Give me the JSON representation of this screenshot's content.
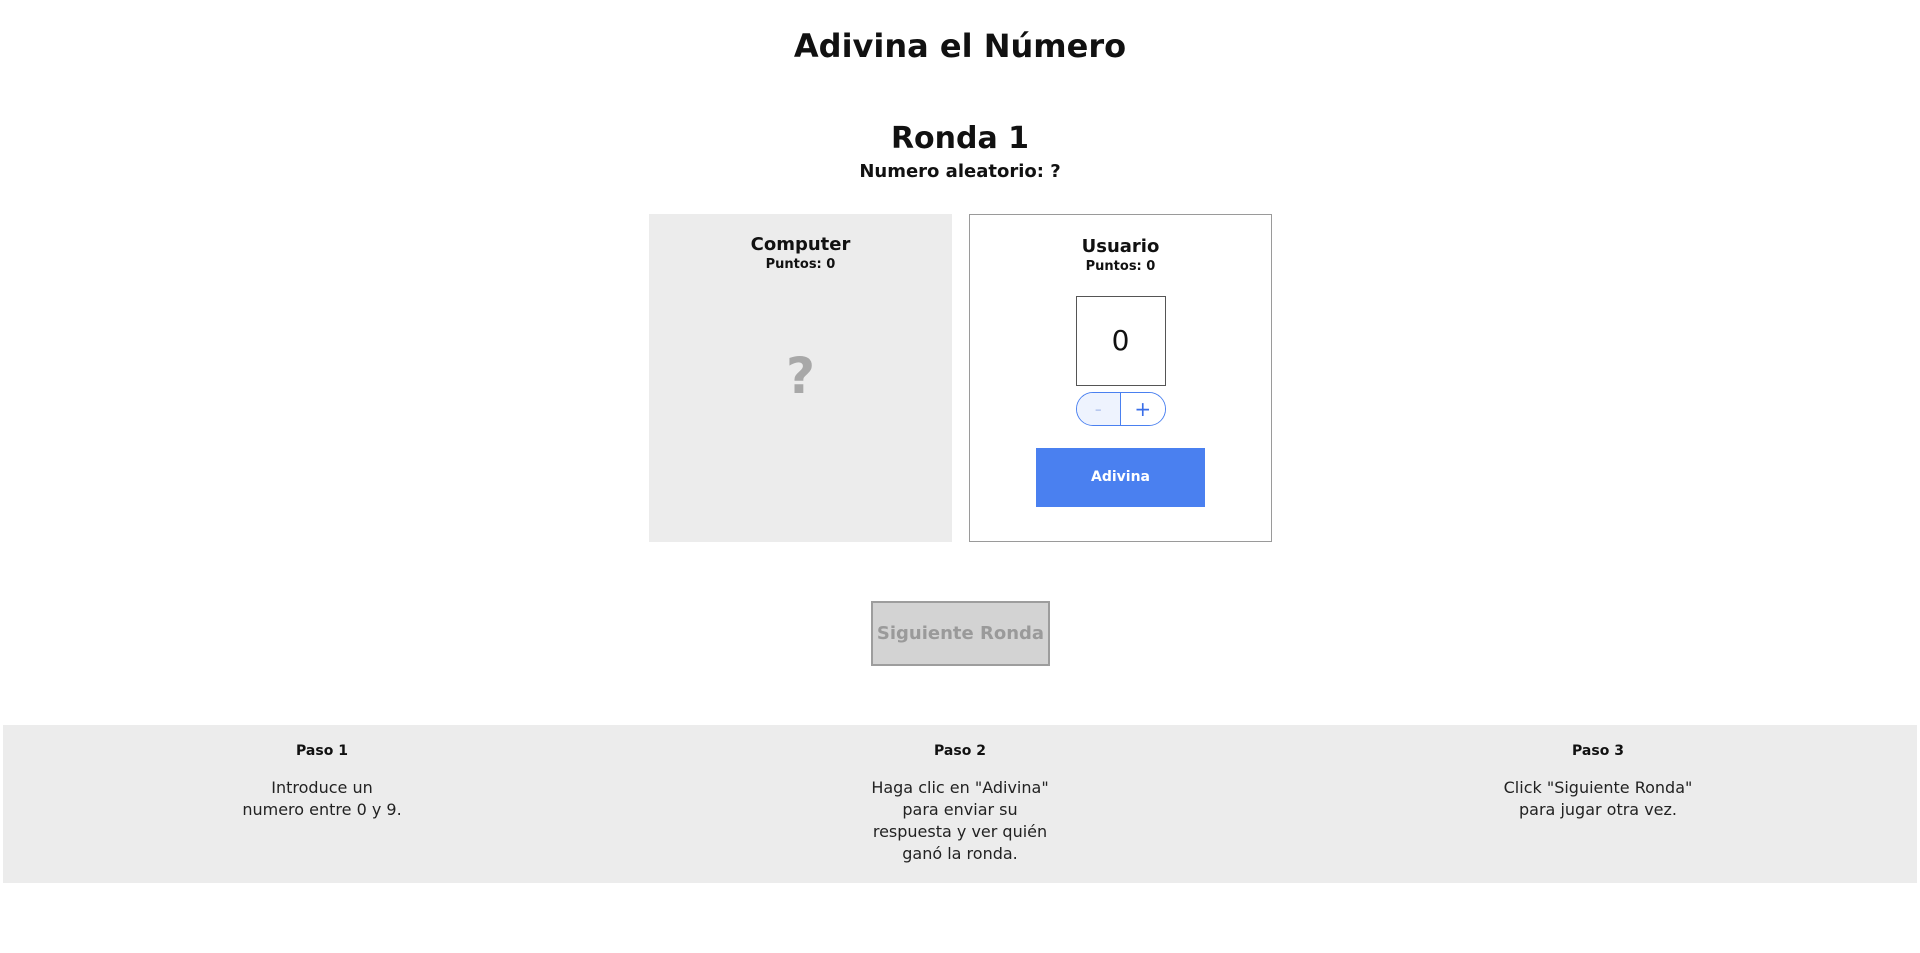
{
  "header": {
    "title": "Adivina el Número"
  },
  "round": {
    "title": "Ronda 1",
    "random_label": "Numero aleatorio: ?"
  },
  "computer": {
    "name": "Computer",
    "points_label": "Puntos: 0",
    "guess_display": "?"
  },
  "user": {
    "name": "Usuario",
    "points_label": "Puntos: 0",
    "guess_value": "0",
    "decrement_label": "-",
    "increment_label": "+",
    "guess_button_label": "Adivina"
  },
  "next_round": {
    "label": "Siguiente Ronda",
    "enabled": false
  },
  "instructions": [
    {
      "title": "Paso 1",
      "text": "Introduce un numero entre 0 y 9."
    },
    {
      "title": "Paso 2",
      "text": "Haga clic en \"Adivina\" para enviar su respuesta y ver quién ganó la ronda."
    },
    {
      "title": "Paso 3",
      "text": "Click \"Siguiente Ronda\" para jugar otra vez."
    }
  ],
  "colors": {
    "accent": "#4a80f0",
    "panel_background": "#ececec",
    "disabled_button": "#d3d3d3"
  }
}
